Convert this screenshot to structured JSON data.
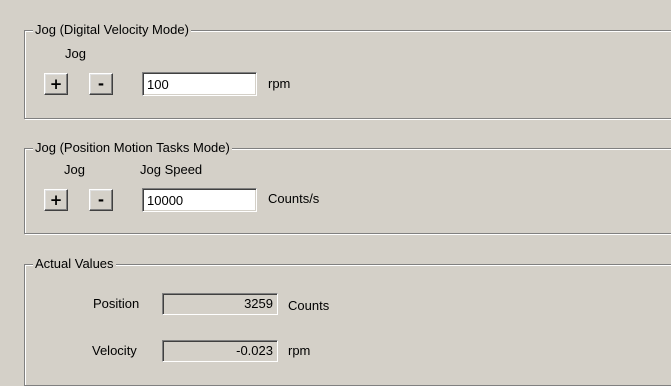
{
  "jog_velocity": {
    "title": "Jog (Digital Velocity Mode)",
    "jog_label": "Jog",
    "plus_label": "+",
    "minus_label": "-",
    "speed_value": "100",
    "unit": "rpm"
  },
  "jog_position": {
    "title": "Jog (Position Motion Tasks Mode)",
    "jog_label": "Jog",
    "speed_label": "Jog Speed",
    "plus_label": "+",
    "minus_label": "-",
    "speed_value": "10000",
    "unit": "Counts/s"
  },
  "actual_values": {
    "title": "Actual Values",
    "position_label": "Position",
    "position_value": "3259",
    "position_unit": "Counts",
    "velocity_label": "Velocity",
    "velocity_value": "-0.023",
    "velocity_unit": "rpm"
  }
}
